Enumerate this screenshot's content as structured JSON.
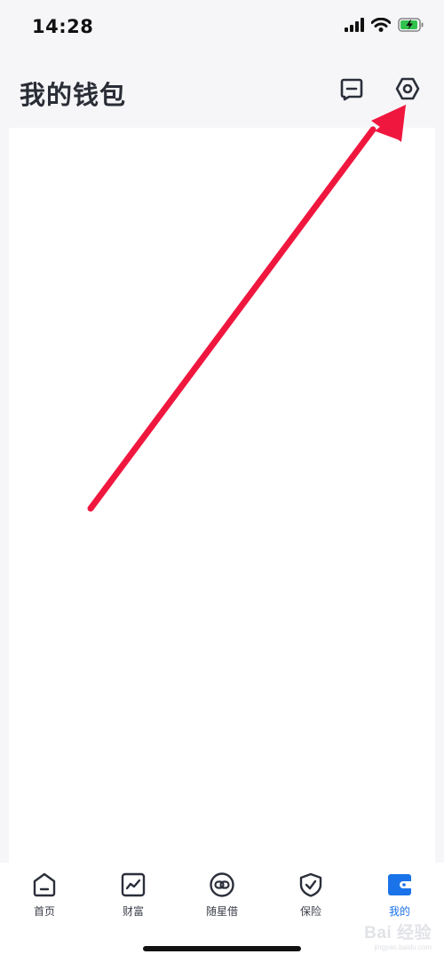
{
  "status_bar": {
    "time": "14:28"
  },
  "header": {
    "title": "我的钱包",
    "message_icon": "message-icon",
    "settings_icon": "settings-hexagon-icon"
  },
  "tabs": [
    {
      "label": "首页",
      "icon": "home-icon",
      "active": false
    },
    {
      "label": "财富",
      "icon": "wealth-chart-icon",
      "active": false
    },
    {
      "label": "随星借",
      "icon": "loan-link-icon",
      "active": false
    },
    {
      "label": "保险",
      "icon": "insurance-shield-icon",
      "active": false
    },
    {
      "label": "我的",
      "icon": "wallet-icon",
      "active": true
    }
  ],
  "watermark": {
    "logo": "Bai 经验",
    "url": "jingyan.baidu.com"
  },
  "colors": {
    "accent": "#1a73e8",
    "annotation_arrow": "#f0173f",
    "background": "#f6f6f8"
  }
}
